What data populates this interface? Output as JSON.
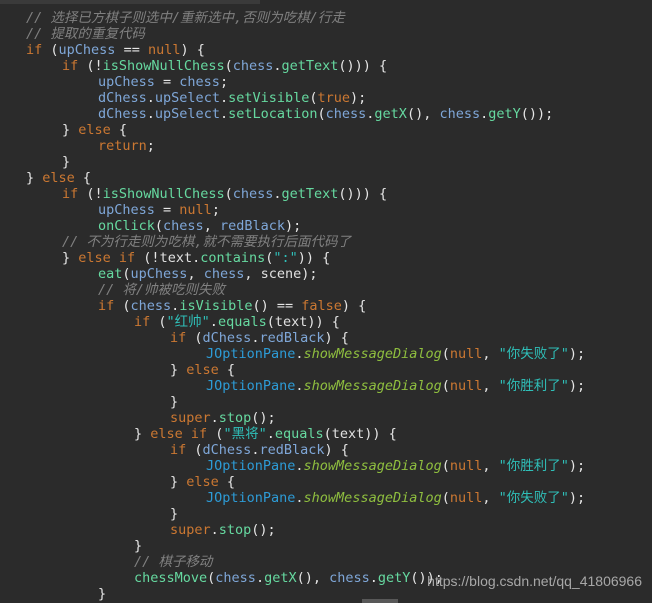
{
  "editor": {
    "colors": {
      "background": "#2b2b2b",
      "comment": "#808080",
      "keyword": "#cc7832",
      "field": "#7fa7d8",
      "method": "#66d9a0",
      "string": "#2fbfb8",
      "class": "#2d9bd6",
      "static_method": "#8fbf3f"
    },
    "lines": [
      {
        "indent": 0,
        "tokens": [
          {
            "t": "comment",
            "v": "// 选择已方棋子则选中/重新选中,否则为吃棋/行走"
          }
        ]
      },
      {
        "indent": 0,
        "tokens": [
          {
            "t": "comment",
            "v": "// 提取的重复代码"
          }
        ]
      },
      {
        "indent": 0,
        "tokens": [
          {
            "t": "keyword",
            "v": "if"
          },
          {
            "t": "punc",
            "v": " ("
          },
          {
            "t": "field",
            "v": "upChess"
          },
          {
            "t": "op",
            "v": " == "
          },
          {
            "t": "keyword",
            "v": "null"
          },
          {
            "t": "punc",
            "v": ") {"
          }
        ]
      },
      {
        "indent": 1,
        "tokens": [
          {
            "t": "keyword",
            "v": "if"
          },
          {
            "t": "punc",
            "v": " (!"
          },
          {
            "t": "method",
            "v": "isShowNullChess"
          },
          {
            "t": "punc",
            "v": "("
          },
          {
            "t": "field",
            "v": "chess"
          },
          {
            "t": "punc",
            "v": "."
          },
          {
            "t": "method",
            "v": "getText"
          },
          {
            "t": "punc",
            "v": "())) {"
          }
        ]
      },
      {
        "indent": 2,
        "tokens": [
          {
            "t": "field",
            "v": "upChess"
          },
          {
            "t": "op",
            "v": " = "
          },
          {
            "t": "field",
            "v": "chess"
          },
          {
            "t": "punc",
            "v": ";"
          }
        ]
      },
      {
        "indent": 2,
        "tokens": [
          {
            "t": "field",
            "v": "dChess"
          },
          {
            "t": "punc",
            "v": "."
          },
          {
            "t": "field",
            "v": "upSelect"
          },
          {
            "t": "punc",
            "v": "."
          },
          {
            "t": "method",
            "v": "setVisible"
          },
          {
            "t": "punc",
            "v": "("
          },
          {
            "t": "keyword",
            "v": "true"
          },
          {
            "t": "punc",
            "v": ");"
          }
        ]
      },
      {
        "indent": 2,
        "tokens": [
          {
            "t": "field",
            "v": "dChess"
          },
          {
            "t": "punc",
            "v": "."
          },
          {
            "t": "field",
            "v": "upSelect"
          },
          {
            "t": "punc",
            "v": "."
          },
          {
            "t": "method",
            "v": "setLocation"
          },
          {
            "t": "punc",
            "v": "("
          },
          {
            "t": "field",
            "v": "chess"
          },
          {
            "t": "punc",
            "v": "."
          },
          {
            "t": "method",
            "v": "getX"
          },
          {
            "t": "punc",
            "v": "(), "
          },
          {
            "t": "field",
            "v": "chess"
          },
          {
            "t": "punc",
            "v": "."
          },
          {
            "t": "method",
            "v": "getY"
          },
          {
            "t": "punc",
            "v": "());"
          }
        ]
      },
      {
        "indent": 1,
        "tokens": [
          {
            "t": "punc",
            "v": "} "
          },
          {
            "t": "keyword",
            "v": "else"
          },
          {
            "t": "punc",
            "v": " {"
          }
        ]
      },
      {
        "indent": 2,
        "tokens": [
          {
            "t": "keyword",
            "v": "return"
          },
          {
            "t": "punc",
            "v": ";"
          }
        ]
      },
      {
        "indent": 1,
        "tokens": [
          {
            "t": "punc",
            "v": "}"
          }
        ]
      },
      {
        "indent": 0,
        "tokens": [
          {
            "t": "punc",
            "v": "} "
          },
          {
            "t": "keyword",
            "v": "else"
          },
          {
            "t": "punc",
            "v": " {"
          }
        ]
      },
      {
        "indent": 1,
        "tokens": [
          {
            "t": "keyword",
            "v": "if"
          },
          {
            "t": "punc",
            "v": " (!"
          },
          {
            "t": "method",
            "v": "isShowNullChess"
          },
          {
            "t": "punc",
            "v": "("
          },
          {
            "t": "field",
            "v": "chess"
          },
          {
            "t": "punc",
            "v": "."
          },
          {
            "t": "method",
            "v": "getText"
          },
          {
            "t": "punc",
            "v": "())) {"
          }
        ]
      },
      {
        "indent": 2,
        "tokens": [
          {
            "t": "field",
            "v": "upChess"
          },
          {
            "t": "op",
            "v": " = "
          },
          {
            "t": "keyword",
            "v": "null"
          },
          {
            "t": "punc",
            "v": ";"
          }
        ]
      },
      {
        "indent": 2,
        "tokens": [
          {
            "t": "method",
            "v": "onClick"
          },
          {
            "t": "punc",
            "v": "("
          },
          {
            "t": "field",
            "v": "chess"
          },
          {
            "t": "punc",
            "v": ", "
          },
          {
            "t": "field",
            "v": "redBlack"
          },
          {
            "t": "punc",
            "v": ");"
          }
        ]
      },
      {
        "indent": 1,
        "tokens": [
          {
            "t": "comment",
            "v": "// 不为行走则为吃棋,就不需要执行后面代码了"
          }
        ]
      },
      {
        "indent": 1,
        "tokens": [
          {
            "t": "punc",
            "v": "} "
          },
          {
            "t": "keyword",
            "v": "else if"
          },
          {
            "t": "punc",
            "v": " (!"
          },
          {
            "t": "ident",
            "v": "text"
          },
          {
            "t": "punc",
            "v": "."
          },
          {
            "t": "method",
            "v": "contains"
          },
          {
            "t": "punc",
            "v": "("
          },
          {
            "t": "string",
            "v": "\":\""
          },
          {
            "t": "punc",
            "v": ")) {"
          }
        ]
      },
      {
        "indent": 2,
        "tokens": [
          {
            "t": "method",
            "v": "eat"
          },
          {
            "t": "punc",
            "v": "("
          },
          {
            "t": "field",
            "v": "upChess"
          },
          {
            "t": "punc",
            "v": ", "
          },
          {
            "t": "field",
            "v": "chess"
          },
          {
            "t": "punc",
            "v": ", "
          },
          {
            "t": "ident",
            "v": "scene"
          },
          {
            "t": "punc",
            "v": ");"
          }
        ]
      },
      {
        "indent": 2,
        "tokens": [
          {
            "t": "comment",
            "v": "// 将/帅被吃则失败"
          }
        ]
      },
      {
        "indent": 2,
        "tokens": [
          {
            "t": "keyword",
            "v": "if"
          },
          {
            "t": "punc",
            "v": " ("
          },
          {
            "t": "field",
            "v": "chess"
          },
          {
            "t": "punc",
            "v": "."
          },
          {
            "t": "method",
            "v": "isVisible"
          },
          {
            "t": "punc",
            "v": "() == "
          },
          {
            "t": "keyword",
            "v": "false"
          },
          {
            "t": "punc",
            "v": ") {"
          }
        ]
      },
      {
        "indent": 3,
        "tokens": [
          {
            "t": "keyword",
            "v": "if"
          },
          {
            "t": "punc",
            "v": " ("
          },
          {
            "t": "string",
            "v": "\"红帅\""
          },
          {
            "t": "punc",
            "v": "."
          },
          {
            "t": "method",
            "v": "equals"
          },
          {
            "t": "punc",
            "v": "("
          },
          {
            "t": "ident",
            "v": "text"
          },
          {
            "t": "punc",
            "v": ")) {"
          }
        ]
      },
      {
        "indent": 4,
        "tokens": [
          {
            "t": "keyword",
            "v": "if"
          },
          {
            "t": "punc",
            "v": " ("
          },
          {
            "t": "field",
            "v": "dChess"
          },
          {
            "t": "punc",
            "v": "."
          },
          {
            "t": "field",
            "v": "redBlack"
          },
          {
            "t": "punc",
            "v": ") {"
          }
        ]
      },
      {
        "indent": 5,
        "tokens": [
          {
            "t": "class",
            "v": "JOptionPane"
          },
          {
            "t": "punc",
            "v": "."
          },
          {
            "t": "staticmethod",
            "v": "showMessageDialog"
          },
          {
            "t": "punc",
            "v": "("
          },
          {
            "t": "keyword",
            "v": "null"
          },
          {
            "t": "punc",
            "v": ", "
          },
          {
            "t": "string",
            "v": "\"你失败了\""
          },
          {
            "t": "punc",
            "v": ");"
          }
        ]
      },
      {
        "indent": 4,
        "tokens": [
          {
            "t": "punc",
            "v": "} "
          },
          {
            "t": "keyword",
            "v": "else"
          },
          {
            "t": "punc",
            "v": " {"
          }
        ]
      },
      {
        "indent": 5,
        "tokens": [
          {
            "t": "class",
            "v": "JOptionPane"
          },
          {
            "t": "punc",
            "v": "."
          },
          {
            "t": "staticmethod",
            "v": "showMessageDialog"
          },
          {
            "t": "punc",
            "v": "("
          },
          {
            "t": "keyword",
            "v": "null"
          },
          {
            "t": "punc",
            "v": ", "
          },
          {
            "t": "string",
            "v": "\"你胜利了\""
          },
          {
            "t": "punc",
            "v": ");"
          }
        ]
      },
      {
        "indent": 4,
        "tokens": [
          {
            "t": "punc",
            "v": "}"
          }
        ]
      },
      {
        "indent": 4,
        "tokens": [
          {
            "t": "keyword",
            "v": "super"
          },
          {
            "t": "punc",
            "v": "."
          },
          {
            "t": "method",
            "v": "stop"
          },
          {
            "t": "punc",
            "v": "();"
          }
        ]
      },
      {
        "indent": 3,
        "tokens": [
          {
            "t": "punc",
            "v": "} "
          },
          {
            "t": "keyword",
            "v": "else if"
          },
          {
            "t": "punc",
            "v": " ("
          },
          {
            "t": "string",
            "v": "\"黑将\""
          },
          {
            "t": "punc",
            "v": "."
          },
          {
            "t": "method",
            "v": "equals"
          },
          {
            "t": "punc",
            "v": "("
          },
          {
            "t": "ident",
            "v": "text"
          },
          {
            "t": "punc",
            "v": ")) {"
          }
        ]
      },
      {
        "indent": 4,
        "tokens": [
          {
            "t": "keyword",
            "v": "if"
          },
          {
            "t": "punc",
            "v": " ("
          },
          {
            "t": "field",
            "v": "dChess"
          },
          {
            "t": "punc",
            "v": "."
          },
          {
            "t": "field",
            "v": "redBlack"
          },
          {
            "t": "punc",
            "v": ") {"
          }
        ]
      },
      {
        "indent": 5,
        "tokens": [
          {
            "t": "class",
            "v": "JOptionPane"
          },
          {
            "t": "punc",
            "v": "."
          },
          {
            "t": "staticmethod",
            "v": "showMessageDialog"
          },
          {
            "t": "punc",
            "v": "("
          },
          {
            "t": "keyword",
            "v": "null"
          },
          {
            "t": "punc",
            "v": ", "
          },
          {
            "t": "string",
            "v": "\"你胜利了\""
          },
          {
            "t": "punc",
            "v": ");"
          }
        ]
      },
      {
        "indent": 4,
        "tokens": [
          {
            "t": "punc",
            "v": "} "
          },
          {
            "t": "keyword",
            "v": "else"
          },
          {
            "t": "punc",
            "v": " {"
          }
        ]
      },
      {
        "indent": 5,
        "tokens": [
          {
            "t": "class",
            "v": "JOptionPane"
          },
          {
            "t": "punc",
            "v": "."
          },
          {
            "t": "staticmethod",
            "v": "showMessageDialog"
          },
          {
            "t": "punc",
            "v": "("
          },
          {
            "t": "keyword",
            "v": "null"
          },
          {
            "t": "punc",
            "v": ", "
          },
          {
            "t": "string",
            "v": "\"你失败了\""
          },
          {
            "t": "punc",
            "v": ");"
          }
        ]
      },
      {
        "indent": 4,
        "tokens": [
          {
            "t": "punc",
            "v": "}"
          }
        ]
      },
      {
        "indent": 4,
        "tokens": [
          {
            "t": "keyword",
            "v": "super"
          },
          {
            "t": "punc",
            "v": "."
          },
          {
            "t": "method",
            "v": "stop"
          },
          {
            "t": "punc",
            "v": "();"
          }
        ]
      },
      {
        "indent": 3,
        "tokens": [
          {
            "t": "punc",
            "v": "}"
          }
        ]
      },
      {
        "indent": 3,
        "tokens": [
          {
            "t": "comment",
            "v": "// 棋子移动"
          }
        ]
      },
      {
        "indent": 3,
        "tokens": [
          {
            "t": "method",
            "v": "chessMove"
          },
          {
            "t": "punc",
            "v": "("
          },
          {
            "t": "field",
            "v": "chess"
          },
          {
            "t": "punc",
            "v": "."
          },
          {
            "t": "method",
            "v": "getX"
          },
          {
            "t": "punc",
            "v": "(), "
          },
          {
            "t": "field",
            "v": "chess"
          },
          {
            "t": "punc",
            "v": "."
          },
          {
            "t": "method",
            "v": "getY"
          },
          {
            "t": "punc",
            "v": "());"
          }
        ]
      },
      {
        "indent": 2,
        "tokens": [
          {
            "t": "punc",
            "v": "}"
          }
        ]
      }
    ]
  },
  "watermark": "https://blog.csdn.net/qq_41806966"
}
